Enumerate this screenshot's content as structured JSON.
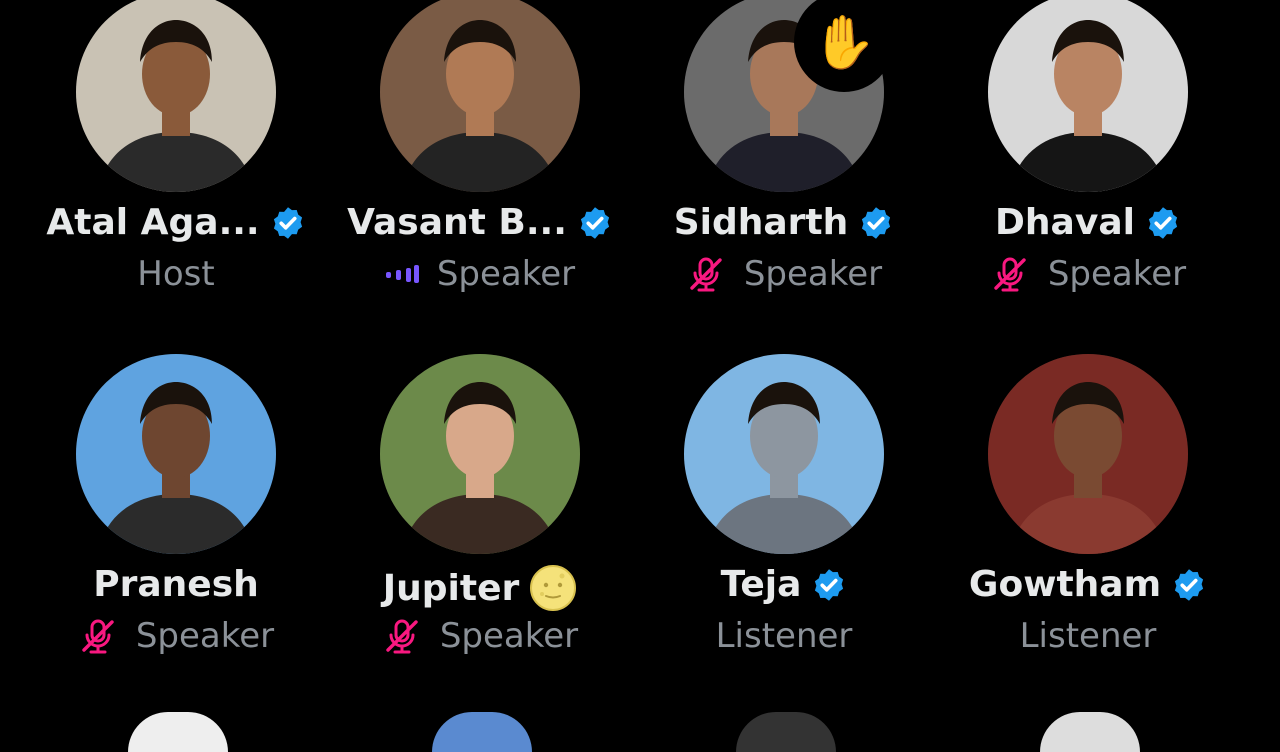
{
  "participants": [
    {
      "name": "Atal Aga...",
      "role": "Host",
      "verified": true,
      "mic": "none",
      "avatar_bg": "#c9c2b4",
      "skin": "#8a5a3a",
      "shirt": "#2a2a2a"
    },
    {
      "name": "Vasant B...",
      "role": "Speaker",
      "verified": true,
      "mic": "speaking",
      "avatar_bg": "#7a5b45",
      "skin": "#b07a55",
      "shirt": "#232323"
    },
    {
      "name": "Sidharth",
      "role": "Speaker",
      "verified": true,
      "mic": "muted",
      "avatar_bg": "#6b6b6b",
      "skin": "#a8785a",
      "shirt": "#1f1f2a",
      "hand_raised": true
    },
    {
      "name": "Dhaval",
      "role": "Speaker",
      "verified": true,
      "mic": "muted",
      "avatar_bg": "#d8d8d8",
      "skin": "#b98463",
      "shirt": "#151515"
    },
    {
      "name": "Pranesh",
      "role": "Speaker",
      "verified": false,
      "mic": "muted",
      "avatar_bg": "#5fa3e0",
      "skin": "#6e4630",
      "shirt": "#2b2b2b"
    },
    {
      "name": "Jupiter",
      "role": "Speaker",
      "verified": false,
      "mic": "muted",
      "emoji": "moon-face",
      "avatar_bg": "#6c8a4a",
      "skin": "#d8a88a",
      "shirt": "#3a2a22"
    },
    {
      "name": "Teja",
      "role": "Listener",
      "verified": true,
      "mic": "none",
      "avatar_bg": "#7fb6e3",
      "skin": "#8d96a0",
      "shirt": "#6c7580"
    },
    {
      "name": "Gowtham",
      "role": "Listener",
      "verified": true,
      "mic": "none",
      "avatar_bg": "#7a2a24",
      "skin": "#7a4a32",
      "shirt": "#8a3a30"
    }
  ],
  "hand_icon": "✋",
  "colors": {
    "background": "#000000",
    "verified": "#1d9bf0",
    "muted": "#f91880",
    "speaking": "#7856ff",
    "role_text": "#8b9198"
  }
}
